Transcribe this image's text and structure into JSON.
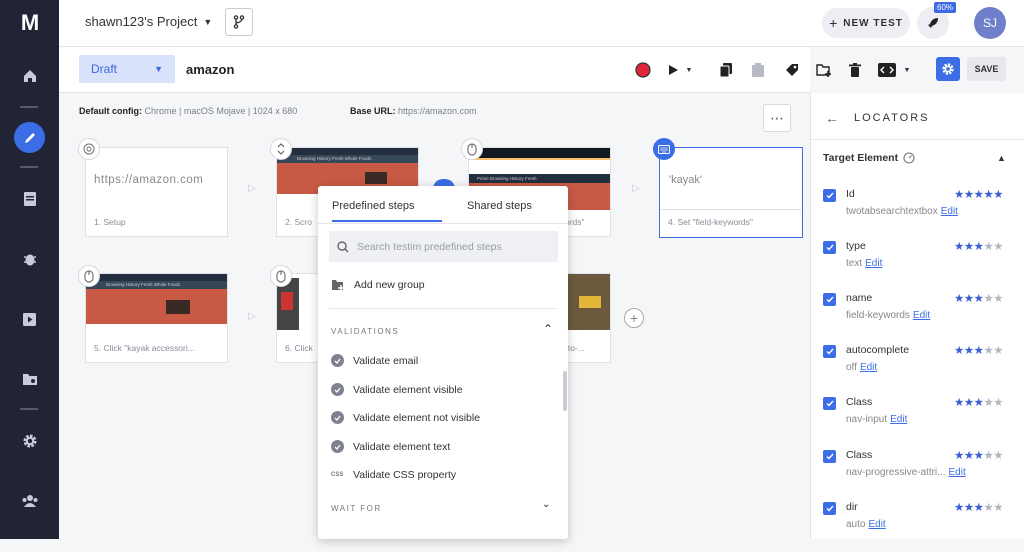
{
  "app": {
    "logo": "M"
  },
  "header": {
    "project": "shawn123's Project",
    "new_test": "NEW TEST",
    "rocket_badge": "60%",
    "avatar": "SJ"
  },
  "toolbar": {
    "status": "Draft",
    "test_name": "amazon",
    "save": "SAVE"
  },
  "config": {
    "default_label": "Default config:",
    "default_value": "Chrome | macOS Mojave | 1024 x 680",
    "base_label": "Base URL:",
    "base_value": "https://amazon.com"
  },
  "steps": [
    {
      "caption": "1. Setup",
      "url": "https://amazon.com"
    },
    {
      "caption": "2. Scro",
      "thumb_text": "Browsing History   Fresh   Whole Foods"
    },
    {
      "caption": "ords\"",
      "thumb_text": "Prime   Browsing History   Fresh"
    },
    {
      "caption": "4. Set \"field-keywords\"",
      "value": "'kayak'"
    },
    {
      "caption": "5. Click \"kayak accessori...",
      "thumb_text": "Browsing History   Fresh   Whole Foods"
    },
    {
      "caption": "6. Click"
    },
    {
      "caption": "-to-..."
    }
  ],
  "popup": {
    "tabs": [
      "Predefined steps",
      "Shared steps"
    ],
    "search_placeholder": "Search testim predefined steps",
    "add_group": "Add new group",
    "validations_title": "VALIDATIONS",
    "items": [
      "Validate email",
      "Validate element visible",
      "Validate element not visible",
      "Validate element text",
      "Validate CSS property"
    ],
    "css_tag": "CSS",
    "wait_title": "WAIT FOR"
  },
  "locators": {
    "title": "LOCATORS",
    "target": "Target Element",
    "edit": "Edit",
    "items": [
      {
        "name": "Id",
        "value": "twotabsearchtextbox",
        "stars": 5
      },
      {
        "name": "type",
        "value": "text",
        "stars": 3
      },
      {
        "name": "name",
        "value": "field-keywords",
        "stars": 3
      },
      {
        "name": "autocomplete",
        "value": "off",
        "stars": 3
      },
      {
        "name": "Class",
        "value": "nav-input",
        "stars": 3
      },
      {
        "name": "Class",
        "value": "nav-progressive-attri...",
        "stars": 3
      },
      {
        "name": "dir",
        "value": "auto",
        "stars": 3
      }
    ]
  }
}
